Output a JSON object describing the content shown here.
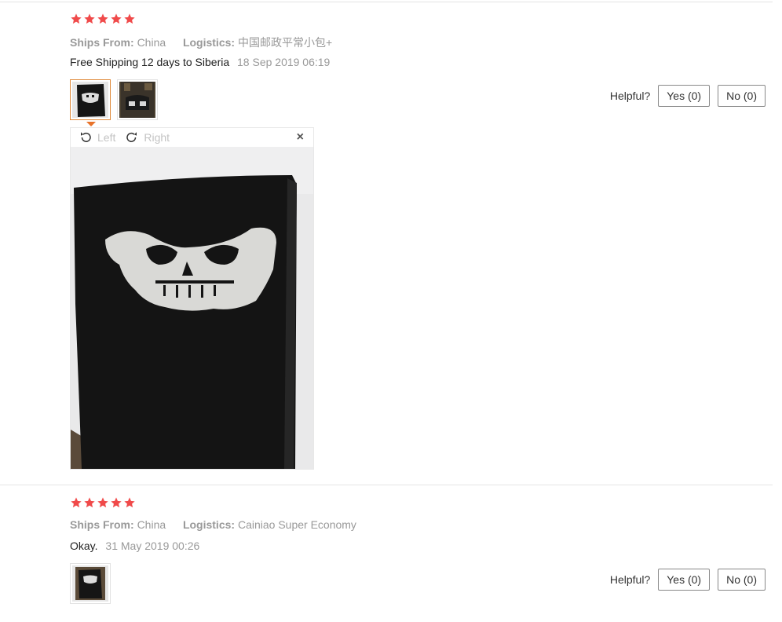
{
  "reviews": [
    {
      "rating": 5,
      "ships_from_label": "Ships From:",
      "ships_from": "China",
      "logistics_label": "Logistics:",
      "logistics": "中国邮政平常小包+",
      "text": "Free Shipping 12 days to Siberia",
      "date": "18 Sep 2019 06:19",
      "helpful_label": "Helpful?",
      "yes_label": "Yes (0)",
      "no_label": "No (0)",
      "viewer": {
        "left_label": "Left",
        "right_label": "Right",
        "close_glyph": "×"
      }
    },
    {
      "rating": 5,
      "ships_from_label": "Ships From:",
      "ships_from": "China",
      "logistics_label": "Logistics:",
      "logistics": "Cainiao Super Economy",
      "text": "Okay.",
      "date": "31 May 2019 00:26",
      "helpful_label": "Helpful?",
      "yes_label": "Yes (0)",
      "no_label": "No (0)"
    }
  ],
  "icons": {
    "star": "star-icon",
    "rotate_left": "rotate-left-icon",
    "rotate_right": "rotate-right-icon",
    "close": "close-icon"
  },
  "colors": {
    "star": "#f04a4a",
    "selected_thumb": "#e08a3a",
    "muted_text": "#999999"
  }
}
